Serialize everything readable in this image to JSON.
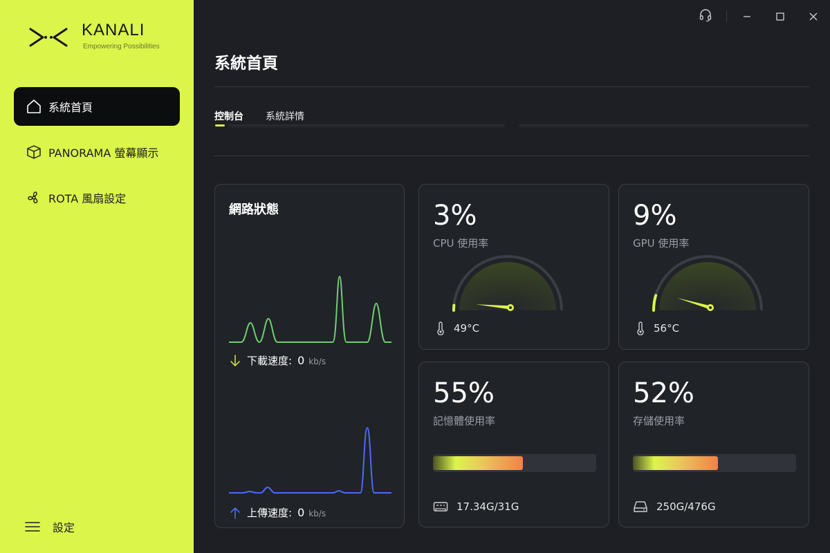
{
  "brand": {
    "name": "KANALI",
    "tagline": "Empowering Possibilities"
  },
  "sidebar": {
    "items": [
      {
        "label": "系統首頁",
        "icon": "home-icon",
        "active": true
      },
      {
        "label": "PANORAMA 螢幕顯示",
        "icon": "box-icon",
        "active": false
      },
      {
        "label": "ROTA 風扇設定",
        "icon": "fan-icon",
        "active": false
      }
    ],
    "settings_label": "設定"
  },
  "window": {
    "icons": [
      "headset-icon",
      "minimize-icon",
      "maximize-icon",
      "close-icon"
    ]
  },
  "main": {
    "title": "系統首頁",
    "tabs": [
      {
        "label": "控制台",
        "active": true
      },
      {
        "label": "系統詳情",
        "active": false
      }
    ]
  },
  "network": {
    "title": "網路狀態",
    "download_label": "下載速度:",
    "download_value": "0",
    "download_unit": "kb/s",
    "upload_label": "上傳速度:",
    "upload_value": "0",
    "upload_unit": "kb/s",
    "download_color": "#6fcf6f",
    "upload_color": "#4a6cf7"
  },
  "cpu": {
    "value": "3%",
    "label": "CPU 使用率",
    "percent": 3,
    "temp": "49°C"
  },
  "gpu": {
    "value": "9%",
    "label": "GPU 使用率",
    "percent": 9,
    "temp": "56°C"
  },
  "memory": {
    "value": "55%",
    "label": "記憶體使用率",
    "percent": 55,
    "detail": "17.34G/31G"
  },
  "storage": {
    "value": "52%",
    "label": "存儲使用率",
    "percent": 52,
    "detail": "250G/476G"
  },
  "colors": {
    "accent": "#dcf54a",
    "background": "#1d1f24",
    "card": "#202328"
  }
}
